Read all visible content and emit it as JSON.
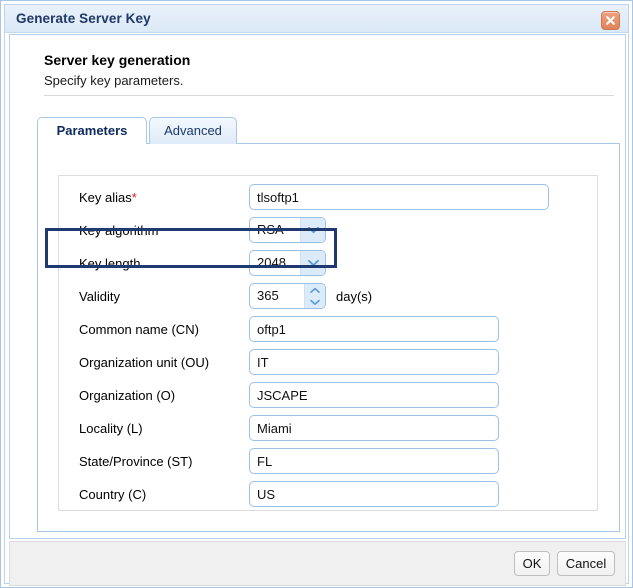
{
  "window": {
    "title": "Generate Server Key",
    "close_icon": "close-icon"
  },
  "header": {
    "heading": "Server key generation",
    "subheading": "Specify key parameters."
  },
  "tabs": [
    {
      "label": "Parameters",
      "active": true
    },
    {
      "label": "Advanced",
      "active": false
    }
  ],
  "form": {
    "fields": [
      {
        "label": "Key alias",
        "required": true,
        "type": "text",
        "value": "tlsoftp1",
        "name": "key-alias"
      },
      {
        "label": "Key algorithm",
        "required": false,
        "type": "select",
        "value": "RSA",
        "name": "key-algorithm"
      },
      {
        "label": "Key length",
        "required": false,
        "type": "select",
        "value": "2048",
        "name": "key-length"
      },
      {
        "label": "Validity",
        "required": false,
        "type": "spinner",
        "value": "365",
        "unit": "day(s)",
        "name": "validity"
      },
      {
        "label": "Common name (CN)",
        "required": false,
        "type": "text",
        "value": "oftp1",
        "name": "common-name"
      },
      {
        "label": "Organization unit (OU)",
        "required": false,
        "type": "text",
        "value": "IT",
        "name": "organization-unit"
      },
      {
        "label": "Organization (O)",
        "required": false,
        "type": "text",
        "value": "JSCAPE",
        "name": "organization"
      },
      {
        "label": "Locality (L)",
        "required": false,
        "type": "text",
        "value": "Miami",
        "name": "locality"
      },
      {
        "label": "State/Province (ST)",
        "required": false,
        "type": "text",
        "value": "FL",
        "name": "state-province"
      },
      {
        "label": "Country (C)",
        "required": false,
        "type": "text",
        "value": "US",
        "name": "country"
      }
    ],
    "required_marker": "*",
    "highlighted_field": "Key length"
  },
  "footer": {
    "ok_label": "OK",
    "cancel_label": "Cancel"
  },
  "colors": {
    "title_text": "#1f3864",
    "titlebar_bg": "#e3eef9",
    "close_button": "#e08458",
    "required_asterisk": "#e01b1b",
    "highlight_border": "#1f3a6e",
    "input_border": "#9cbfe4",
    "combo_button_bg": "#dcebfa",
    "tab_border": "#a9c7e6",
    "footer_bg": "#f0f0f0"
  }
}
